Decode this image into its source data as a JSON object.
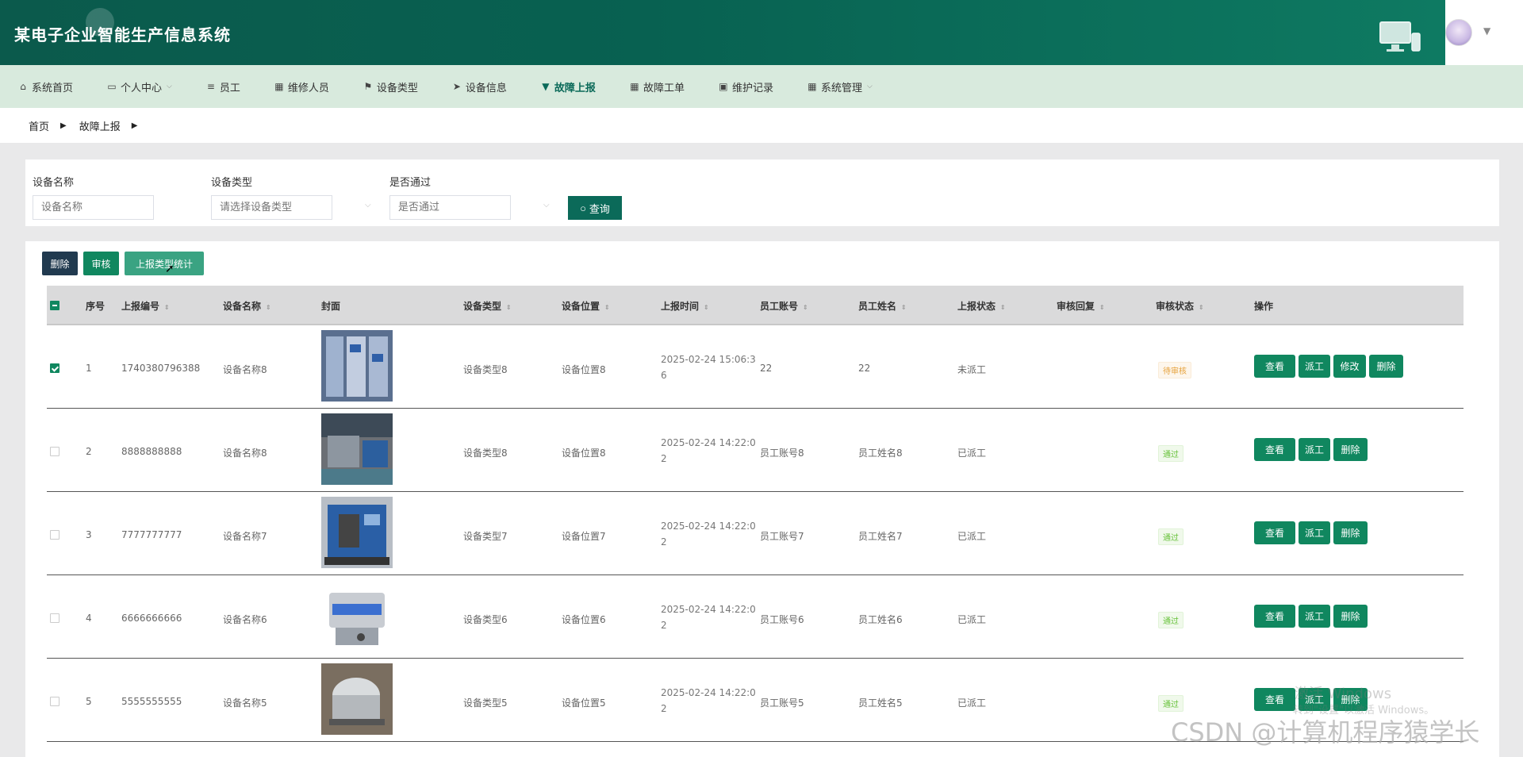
{
  "app": {
    "title": "某电子企业智能生产信息系统"
  },
  "nav": [
    {
      "icon": "home-icon",
      "glyph": "⌂",
      "label": "系统首页",
      "active": false,
      "caret": false
    },
    {
      "icon": "calendar-icon",
      "glyph": "▭",
      "label": "个人中心",
      "active": false,
      "caret": true
    },
    {
      "icon": "list-icon",
      "glyph": "≡",
      "label": "员工",
      "active": false,
      "caret": false
    },
    {
      "icon": "grid-icon",
      "glyph": "▦",
      "label": "维修人员",
      "active": false,
      "caret": false
    },
    {
      "icon": "flag-icon",
      "glyph": "⚑",
      "label": "设备类型",
      "active": false,
      "caret": false
    },
    {
      "icon": "send-icon",
      "glyph": "➤",
      "label": "设备信息",
      "active": false,
      "caret": false
    },
    {
      "icon": "pin-icon",
      "glyph": "▼",
      "label": "故障上报",
      "active": true,
      "caret": false
    },
    {
      "icon": "grid-icon",
      "glyph": "▦",
      "label": "故障工单",
      "active": false,
      "caret": false
    },
    {
      "icon": "clipboard-icon",
      "glyph": "▣",
      "label": "维护记录",
      "active": false,
      "caret": false
    },
    {
      "icon": "grid-icon",
      "glyph": "▦",
      "label": "系统管理",
      "active": false,
      "caret": true
    }
  ],
  "breadcrumb": [
    "首页",
    "故障上报"
  ],
  "search": {
    "device_name_label": "设备名称",
    "device_name_placeholder": "设备名称",
    "device_type_label": "设备类型",
    "device_type_placeholder": "请选择设备类型",
    "passed_label": "是否通过",
    "passed_placeholder": "是否通过",
    "query_label": "查询"
  },
  "actions": {
    "delete": "删除",
    "review": "审核",
    "stats": "上报类型统计"
  },
  "columns": [
    "序号",
    "上报编号",
    "设备名称",
    "封面",
    "设备类型",
    "设备位置",
    "上报时间",
    "员工账号",
    "员工姓名",
    "上报状态",
    "审核回复",
    "审核状态",
    "操作"
  ],
  "rows": [
    {
      "checked": true,
      "index": "1",
      "report_no": "1740380796388",
      "device_name": "设备名称8",
      "device_type": "设备类型8",
      "location": "设备位置8",
      "time": "2025-02-24 15:06:36",
      "account": "22",
      "name": "22",
      "report_status": "未派工",
      "reply": "",
      "review_status": "待审核",
      "review_kind": "pending",
      "ops": [
        "查看",
        "派工",
        "修改",
        "删除"
      ],
      "cover": "blue"
    },
    {
      "checked": false,
      "index": "2",
      "report_no": "8888888888",
      "device_name": "设备名称8",
      "device_type": "设备类型8",
      "location": "设备位置8",
      "time": "2025-02-24 14:22:02",
      "account": "员工账号8",
      "name": "员工姓名8",
      "report_status": "已派工",
      "reply": "",
      "review_status": "通过",
      "review_kind": "pass",
      "ops": [
        "查看",
        "派工",
        "删除"
      ],
      "cover": "factory"
    },
    {
      "checked": false,
      "index": "3",
      "report_no": "7777777777",
      "device_name": "设备名称7",
      "device_type": "设备类型7",
      "location": "设备位置7",
      "time": "2025-02-24 14:22:02",
      "account": "员工账号7",
      "name": "员工姓名7",
      "report_status": "已派工",
      "reply": "",
      "review_status": "通过",
      "review_kind": "pass",
      "ops": [
        "查看",
        "派工",
        "删除"
      ],
      "cover": "machine"
    },
    {
      "checked": false,
      "index": "4",
      "report_no": "6666666666",
      "device_name": "设备名称6",
      "device_type": "设备类型6",
      "location": "设备位置6",
      "time": "2025-02-24 14:22:02",
      "account": "员工账号6",
      "name": "员工姓名6",
      "report_status": "已派工",
      "reply": "",
      "review_status": "通过",
      "review_kind": "pass",
      "ops": [
        "查看",
        "派工",
        "删除"
      ],
      "cover": "white"
    },
    {
      "checked": false,
      "index": "5",
      "report_no": "5555555555",
      "device_name": "设备名称5",
      "device_type": "设备类型5",
      "location": "设备位置5",
      "time": "2025-02-24 14:22:02",
      "account": "员工账号5",
      "name": "员工姓名5",
      "report_status": "已派工",
      "reply": "",
      "review_status": "通过",
      "review_kind": "pass",
      "ops": [
        "查看",
        "派工",
        "删除"
      ],
      "cover": "steel"
    }
  ],
  "watermarks": {
    "activate": "激活 Windows",
    "activate_sub": "转到\"设置\"以激活 Windows。",
    "csdn": "CSDN @计算机程序猿学长"
  },
  "colors": {
    "primary": "#0b6a59",
    "button": "#10875f",
    "nav_bg": "#d8eadd"
  }
}
